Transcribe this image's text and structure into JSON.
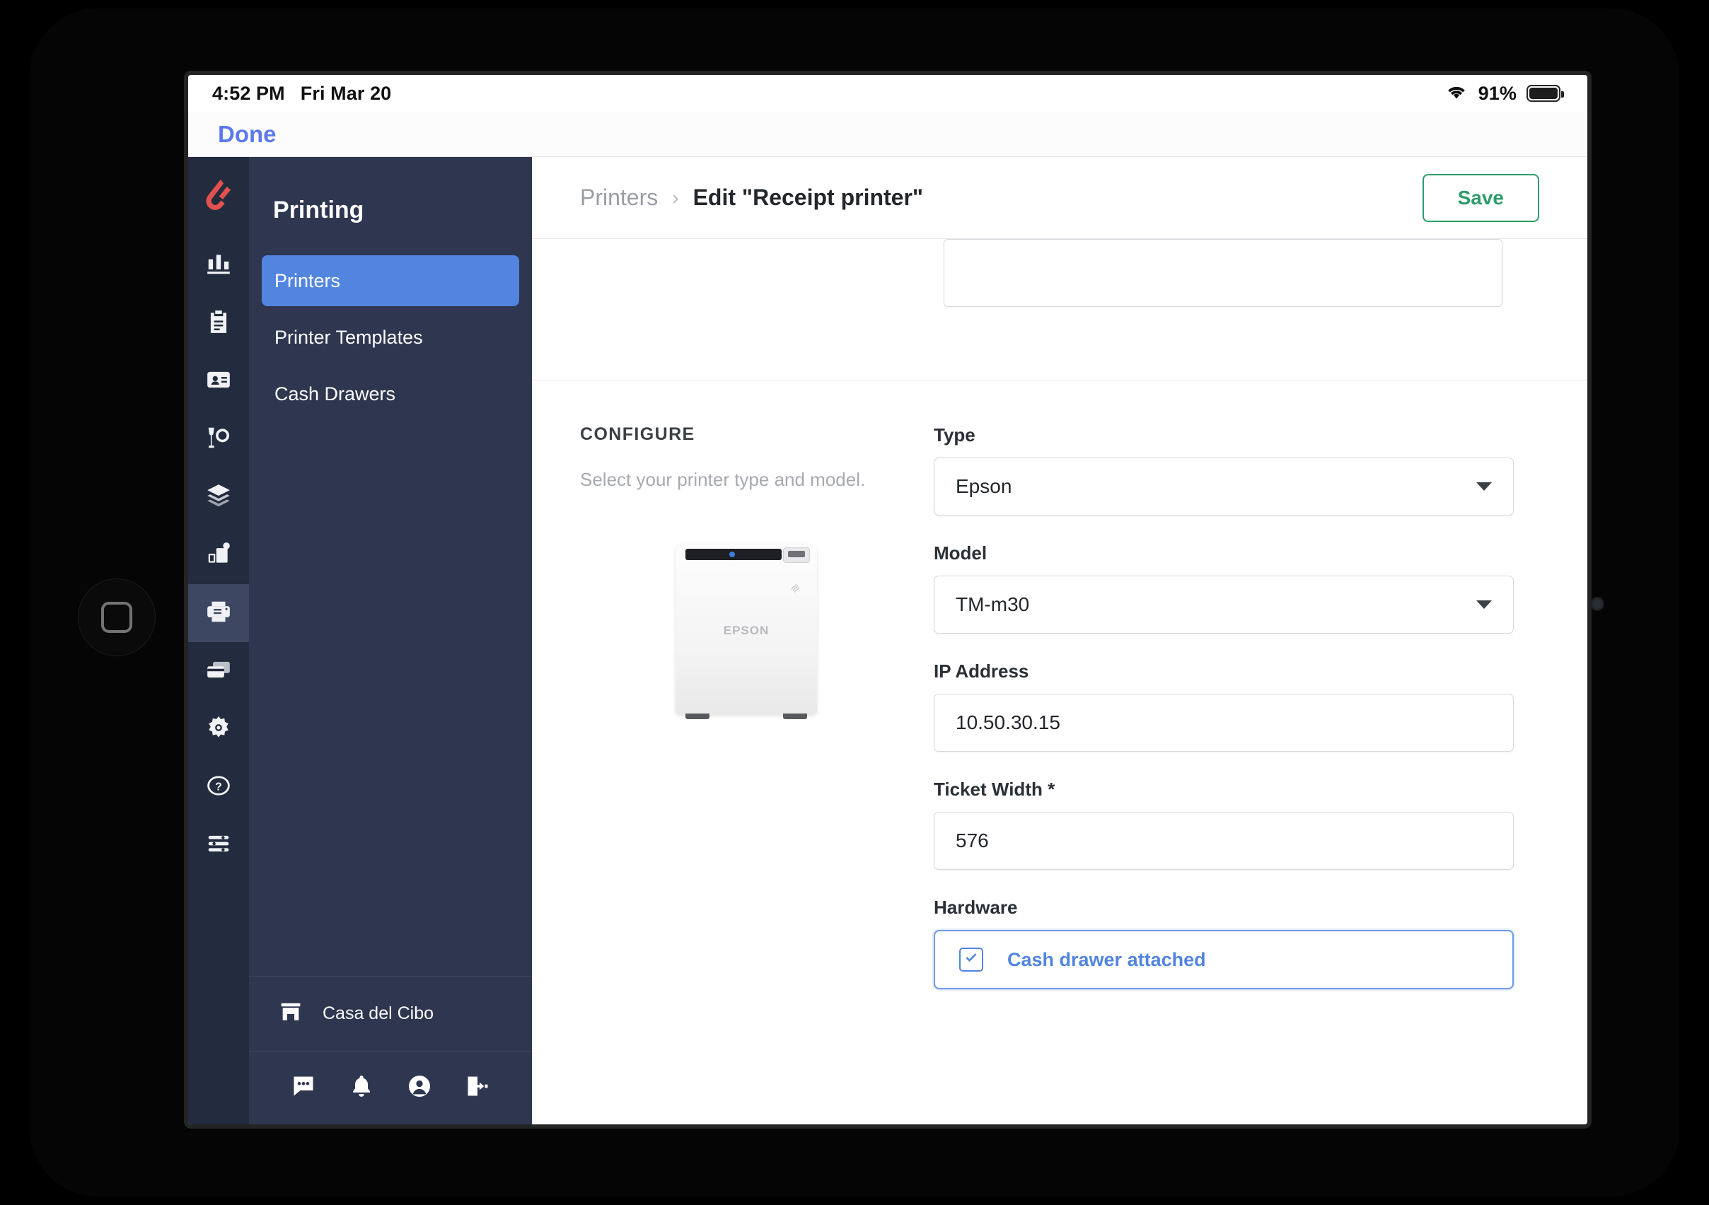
{
  "status_bar": {
    "time": "4:52 PM",
    "date": "Fri Mar 20",
    "battery_percent": "91%",
    "wifi_icon": "wifi-icon",
    "battery_icon": "battery-icon"
  },
  "modal_bar": {
    "done_label": "Done"
  },
  "rail": {
    "logo_icon": "lightspeed-logo-icon",
    "items": [
      {
        "icon": "reports-bar-chart-icon",
        "name": "reports"
      },
      {
        "icon": "clipboard-orders-icon",
        "name": "orders"
      },
      {
        "icon": "customer-card-icon",
        "name": "customers"
      },
      {
        "icon": "dining-glass-plate-icon",
        "name": "dining"
      },
      {
        "icon": "layers-menus-icon",
        "name": "menus"
      },
      {
        "icon": "devices-icon",
        "name": "devices"
      },
      {
        "icon": "printer-icon",
        "name": "printing",
        "active": true
      },
      {
        "icon": "payment-cards-icon",
        "name": "payments"
      },
      {
        "icon": "gear-settings-icon",
        "name": "settings"
      },
      {
        "icon": "help-question-icon",
        "name": "help"
      },
      {
        "icon": "list-menu-icon",
        "name": "list"
      }
    ]
  },
  "sidebar": {
    "title": "Printing",
    "items": [
      {
        "label": "Printers",
        "active": true
      },
      {
        "label": "Printer Templates",
        "active": false
      },
      {
        "label": "Cash Drawers",
        "active": false
      }
    ],
    "store": {
      "name": "Casa del Cibo",
      "icon": "store-icon"
    },
    "footer_icons": [
      {
        "icon": "chat-icon",
        "name": "chat"
      },
      {
        "icon": "bell-notifications-icon",
        "name": "notifications"
      },
      {
        "icon": "account-avatar-icon",
        "name": "account"
      },
      {
        "icon": "logout-icon",
        "name": "logout"
      }
    ]
  },
  "header": {
    "breadcrumb_parent": "Printers",
    "breadcrumb_separator": "›",
    "breadcrumb_current": "Edit \"Receipt printer\"",
    "save_label": "Save"
  },
  "configure": {
    "heading": "CONFIGURE",
    "description": "Select your printer type and model.",
    "printer_image": {
      "brand_text": "EPSON",
      "wifi_glyph": "≋"
    },
    "fields": {
      "type": {
        "label": "Type",
        "value": "Epson"
      },
      "model": {
        "label": "Model",
        "value": "TM-m30"
      },
      "ip_address": {
        "label": "IP Address",
        "value": "10.50.30.15"
      },
      "ticket_width": {
        "label": "Ticket Width *",
        "value": "576"
      },
      "hardware": {
        "label": "Hardware",
        "checkbox_label": "Cash drawer attached",
        "checked": true
      }
    }
  },
  "colors": {
    "accent_blue": "#5285e0",
    "done_blue": "#5b79f0",
    "save_green": "#2f9b6a",
    "sidebar_panel": "#2e3650",
    "icon_rail": "#232b3e",
    "logo_red": "#e2514d"
  }
}
